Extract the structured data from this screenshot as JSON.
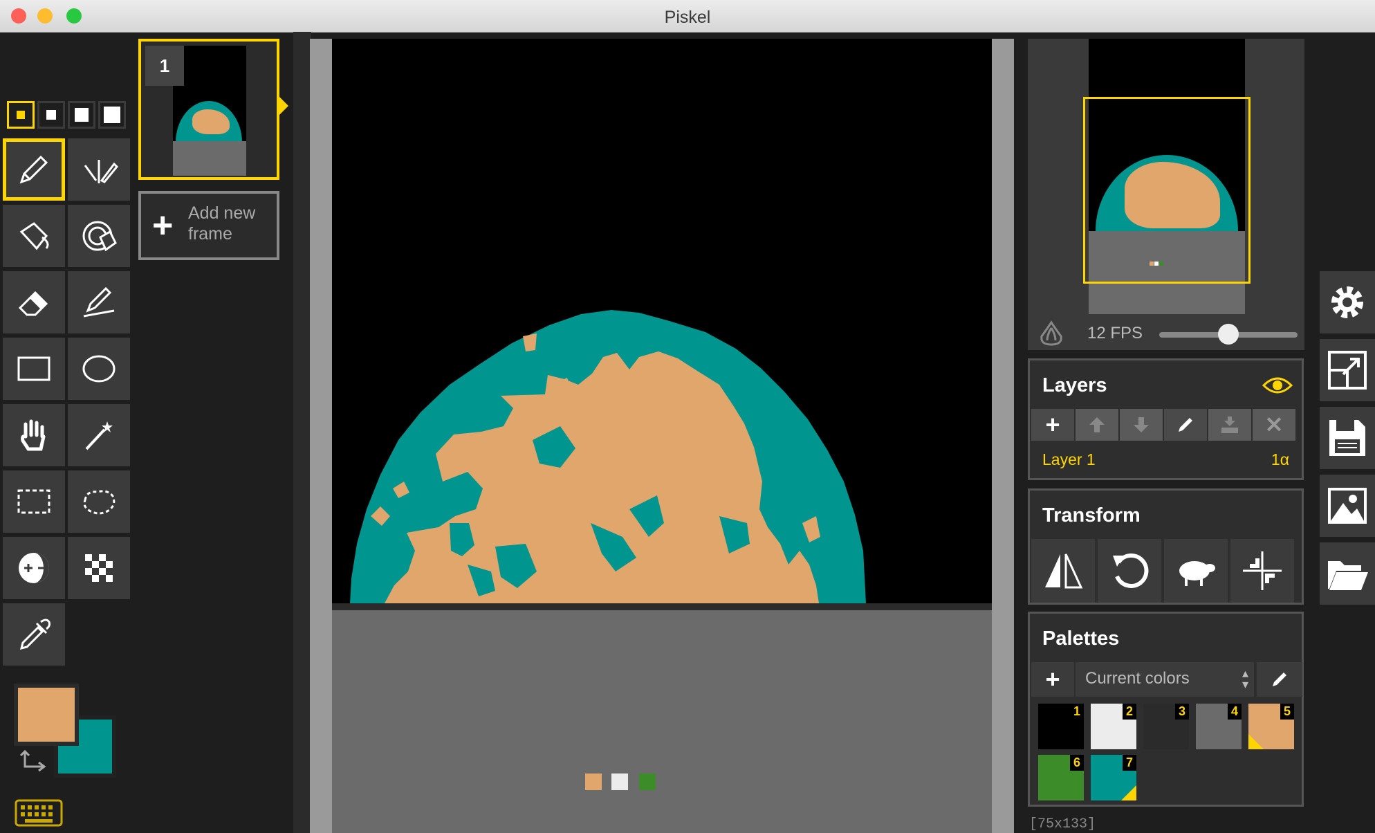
{
  "window": {
    "title": "Piskel"
  },
  "frames": {
    "items": [
      {
        "number": "1"
      }
    ],
    "add_label_line1": "Add new",
    "add_label_line2": "frame"
  },
  "preview": {
    "fps_label": "12 FPS",
    "fps_value": 12,
    "fps_slider_fraction": 0.5,
    "canvas_size": "[75x133]"
  },
  "layers": {
    "title": "Layers",
    "items": [
      {
        "name": "Layer 1",
        "opacity": "1α"
      }
    ]
  },
  "transform": {
    "title": "Transform"
  },
  "palettes": {
    "title": "Palettes",
    "selected": "Current colors",
    "swatches": [
      {
        "num": "1",
        "color": "#000000"
      },
      {
        "num": "2",
        "color": "#ececec"
      },
      {
        "num": "3",
        "color": "#2b2b2b"
      },
      {
        "num": "4",
        "color": "#6b6b6b"
      },
      {
        "num": "5",
        "color": "#e0a66b"
      },
      {
        "num": "6",
        "color": "#3c8c2a"
      },
      {
        "num": "7",
        "color": "#00958f"
      }
    ]
  },
  "colors": {
    "primary": "#e0a66b",
    "secondary": "#00958f",
    "accent": "#ffd500"
  }
}
